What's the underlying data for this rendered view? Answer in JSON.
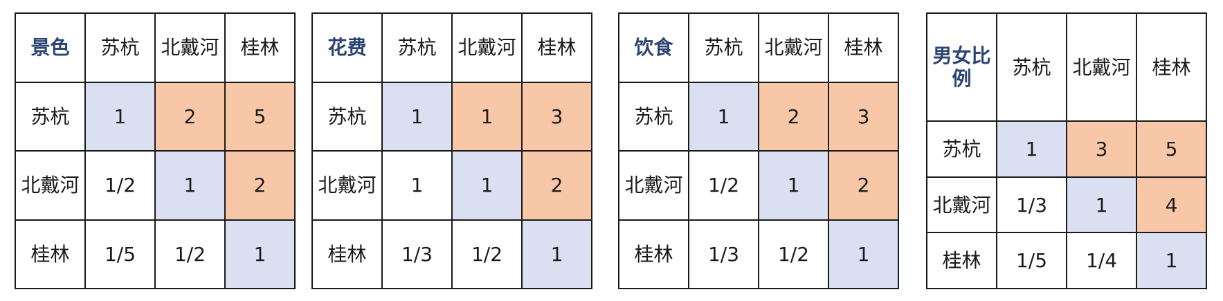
{
  "colors": {
    "criterion_text": "#2b4473",
    "diagonal_fill": "#dae0f2",
    "upper_triangle_fill": "#f7c7a8",
    "grid_line": "#1a1a1a"
  },
  "options": [
    "苏杭",
    "北戴河",
    "桂林"
  ],
  "matrices": [
    {
      "criterion": "景色",
      "header": [
        "苏杭",
        "北戴河",
        "桂林"
      ],
      "rows": [
        {
          "label": "苏杭",
          "cells": [
            "1",
            "2",
            "5"
          ]
        },
        {
          "label": "北戴河",
          "cells": [
            "1/2",
            "1",
            "2"
          ]
        },
        {
          "label": "桂林",
          "cells": [
            "1/5",
            "1/2",
            "1"
          ]
        }
      ]
    },
    {
      "criterion": "花费",
      "header": [
        "苏杭",
        "北戴河",
        "桂林"
      ],
      "rows": [
        {
          "label": "苏杭",
          "cells": [
            "1",
            "1",
            "3"
          ]
        },
        {
          "label": "北戴河",
          "cells": [
            "1",
            "1",
            "2"
          ]
        },
        {
          "label": "桂林",
          "cells": [
            "1/3",
            "1/2",
            "1"
          ]
        }
      ]
    },
    {
      "criterion": "饮食",
      "header": [
        "苏杭",
        "北戴河",
        "桂林"
      ],
      "rows": [
        {
          "label": "苏杭",
          "cells": [
            "1",
            "2",
            "3"
          ]
        },
        {
          "label": "北戴河",
          "cells": [
            "1/2",
            "1",
            "2"
          ]
        },
        {
          "label": "桂林",
          "cells": [
            "1/3",
            "1/2",
            "1"
          ]
        }
      ]
    },
    {
      "criterion": "男女比例",
      "header": [
        "苏杭",
        "北戴河",
        "桂林"
      ],
      "rows": [
        {
          "label": "苏杭",
          "cells": [
            "1",
            "3",
            "5"
          ]
        },
        {
          "label": "北戴河",
          "cells": [
            "1/3",
            "1",
            "4"
          ]
        },
        {
          "label": "桂林",
          "cells": [
            "1/5",
            "1/4",
            "1"
          ]
        }
      ]
    }
  ]
}
